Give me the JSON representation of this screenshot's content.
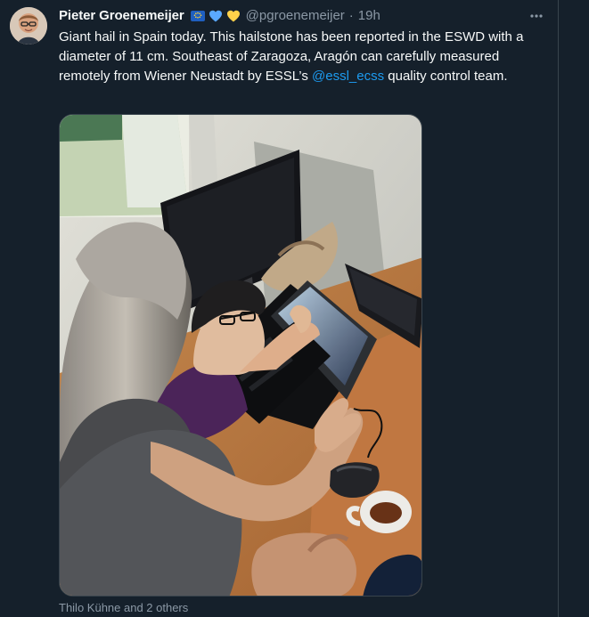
{
  "tweet": {
    "author": {
      "display_name": "Pieter Groenemeijer",
      "handle": "@pgroenemeijer",
      "badges": [
        "eu-flag-icon",
        "blue-heart-icon",
        "yellow-heart-icon"
      ]
    },
    "separator": "·",
    "time": "19h",
    "text": {
      "before_mention": "Giant hail in Spain today. This hailstone has been reported in the ESWD with a diameter of 11 cm. Southeast of Zaragoza, Aragón can carefully measured remotely from Wiener Neustadt by ESSL’s ",
      "mention": "@essl_ecss",
      "after_mention": " quality control team."
    },
    "media_tags": "Thilo Kühne and 2 others"
  },
  "colors": {
    "background": "#15202b",
    "text_primary": "#f7f9f9",
    "text_secondary": "#8b98a5",
    "link": "#1d9bf0",
    "border": "#38444d"
  }
}
